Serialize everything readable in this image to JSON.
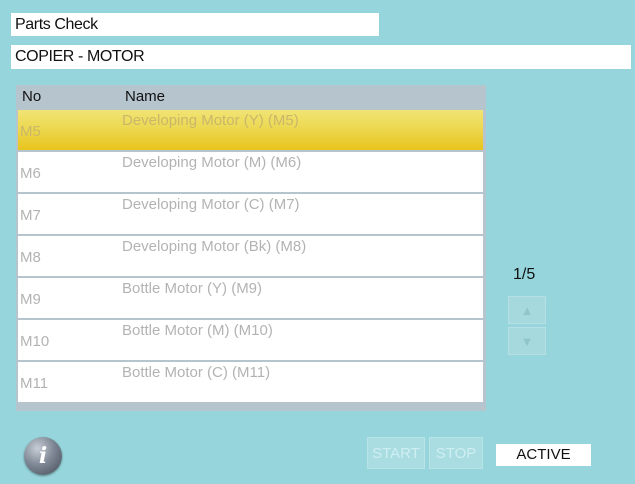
{
  "header": {
    "title": "Parts Check",
    "path": "COPIER - MOTOR"
  },
  "list": {
    "columns": {
      "no": "No",
      "name": "Name"
    },
    "rows": [
      {
        "no": "M5",
        "name": "Developing Motor (Y) (M5)",
        "selected": true
      },
      {
        "no": "M6",
        "name": "Developing Motor (M) (M6)"
      },
      {
        "no": "M7",
        "name": "Developing Motor (C) (M7)"
      },
      {
        "no": "M8",
        "name": "Developing Motor (Bk) (M8)"
      },
      {
        "no": "M9",
        "name": "Bottle Motor (Y) (M9)"
      },
      {
        "no": "M10",
        "name": "Bottle Motor (M) (M10)"
      },
      {
        "no": "M11",
        "name": "Bottle Motor (C) (M11)"
      }
    ]
  },
  "pagination": {
    "indicator": "1/5",
    "up_icon": "▲",
    "down_icon": "▼"
  },
  "footer": {
    "info_icon": "i",
    "start_label": "START",
    "stop_label": "STOP",
    "status": "ACTIVE"
  },
  "colors": {
    "background": "#96d5dc",
    "selected_row": "#ecd851",
    "header_row": "#b6c4ce"
  }
}
